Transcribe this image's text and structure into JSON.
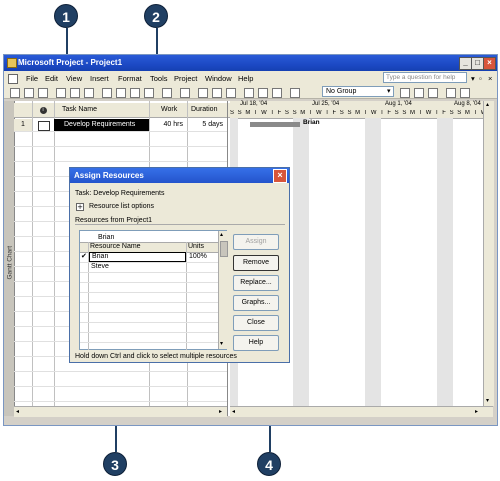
{
  "window": {
    "title": "Microsoft Project - Project1",
    "help_placeholder": "Type a question for help"
  },
  "menu": [
    "File",
    "Edit",
    "View",
    "Insert",
    "Format",
    "Tools",
    "Project",
    "Window",
    "Help"
  ],
  "toolbar": {
    "group_value": "No Group"
  },
  "grid": {
    "columns": {
      "indicator": "",
      "task_name": "Task Name",
      "work": "Work",
      "duration": "Duration"
    },
    "rows": [
      {
        "id": "1",
        "task_name": "Develop Requirements",
        "work": "40 hrs",
        "duration": "5 days"
      }
    ]
  },
  "gantt": {
    "weeks": [
      "Jul 18, '04",
      "Jul 25, '04",
      "Aug 1, '04",
      "Aug 8, '04"
    ],
    "days": "S S M T W T F S S M T W T F S S M T W T F S S M T W T F S S M T W",
    "bar_label": "Brian"
  },
  "side_label": "Gantt Chart",
  "dialog": {
    "title": "Assign Resources",
    "task_line": "Task: Develop Requirements",
    "options_label": "Resource list options",
    "options_toggle": "+",
    "resources_label": "Resources from Project1",
    "edit_value": "Brian",
    "col_name": "Resource Name",
    "col_units": "Units",
    "resources": [
      {
        "check": "✔",
        "name": "Brian",
        "units": "100%"
      },
      {
        "check": "",
        "name": "Steve",
        "units": ""
      }
    ],
    "buttons": {
      "assign": "Assign",
      "remove": "Remove",
      "replace": "Replace...",
      "graphs": "Graphs...",
      "close": "Close",
      "help": "Help"
    },
    "footer": "Hold down Ctrl and click to select multiple resources"
  },
  "callouts": [
    "1",
    "2",
    "3",
    "4"
  ]
}
